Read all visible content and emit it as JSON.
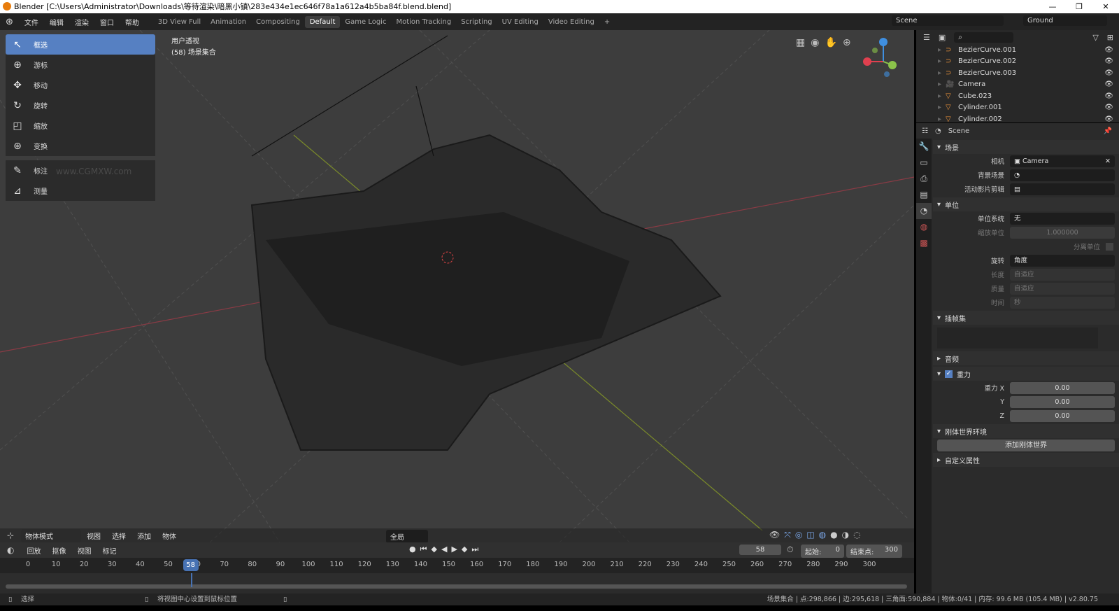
{
  "window": {
    "title": "Blender [C:\\Users\\Administrator\\Downloads\\等待渲染\\暗黑小镇\\283e434e1ec646f78a1a612a4b5ba84f.blend.blend]",
    "controls": [
      "—",
      "❐",
      "✕"
    ]
  },
  "menu": [
    "文件",
    "编辑",
    "渲染",
    "窗口",
    "帮助"
  ],
  "workspaces": [
    {
      "label": "3D View Full"
    },
    {
      "label": "Animation"
    },
    {
      "label": "Compositing"
    },
    {
      "label": "Default",
      "active": true
    },
    {
      "label": "Game Logic"
    },
    {
      "label": "Motion Tracking"
    },
    {
      "label": "Scripting"
    },
    {
      "label": "UV Editing"
    },
    {
      "label": "Video Editing"
    }
  ],
  "add_workspace": "+",
  "scene": {
    "name": "Scene",
    "layer": "Ground"
  },
  "tools": [
    {
      "label": "框选",
      "icon": "select-box-icon",
      "glyph": "↖",
      "active": true
    },
    {
      "label": "游标",
      "icon": "cursor-icon",
      "glyph": "⊕"
    },
    {
      "label": "移动",
      "icon": "move-icon",
      "glyph": "✥"
    },
    {
      "label": "旋转",
      "icon": "rotate-icon",
      "glyph": "↻"
    },
    {
      "label": "缩放",
      "icon": "scale-icon",
      "glyph": "◰"
    },
    {
      "label": "变换",
      "icon": "transform-icon",
      "glyph": "⊛"
    },
    {
      "label": "标注",
      "icon": "annotate-icon",
      "glyph": "✎"
    },
    {
      "label": "测量",
      "icon": "measure-icon",
      "glyph": "📐"
    }
  ],
  "viewport": {
    "view_name": "用户透视",
    "collection": "(58) 场景集合",
    "axis_colors": {
      "x": "#e0404f",
      "y": "#8bc34a",
      "z": "#3f8fe0"
    }
  },
  "viewport_header": {
    "mode": "物体模式",
    "menus": [
      "视图",
      "选择",
      "添加",
      "物体"
    ],
    "orientation": "全局"
  },
  "timeline": {
    "menus": [
      "回放",
      "抠像",
      "视图",
      "标记"
    ],
    "current_frame": "58",
    "start_label": "起始:",
    "start": "0",
    "end_label": "结束点:",
    "end": "300",
    "ticks": [
      0,
      10,
      20,
      30,
      40,
      50,
      60,
      70,
      80,
      90,
      100,
      110,
      120,
      130,
      140,
      150,
      160,
      170,
      180,
      190,
      200,
      210,
      220,
      230,
      240,
      250,
      260,
      270,
      280,
      290,
      300
    ],
    "current": 58
  },
  "outliner": {
    "items": [
      {
        "name": "BezierCurve.001",
        "icon": "curve-icon"
      },
      {
        "name": "BezierCurve.002",
        "icon": "curve-icon"
      },
      {
        "name": "BezierCurve.003",
        "icon": "curve-icon"
      },
      {
        "name": "Camera",
        "icon": "camera-icon"
      },
      {
        "name": "Cube.023",
        "icon": "mesh-icon"
      },
      {
        "name": "Cylinder.001",
        "icon": "mesh-icon"
      },
      {
        "name": "Cylinder.002",
        "icon": "mesh-icon"
      }
    ]
  },
  "properties": {
    "header": "Scene",
    "scene_section": "场景",
    "camera_label": "相机",
    "camera": "Camera",
    "bg_label": "背景场景",
    "clip_label": "活动影片剪辑",
    "units_section": "单位",
    "unit_system_label": "单位系统",
    "unit_system": "无",
    "unit_scale_label": "缩放单位",
    "unit_scale": "1.000000",
    "separate_label": "分离单位",
    "rotation_label": "旋转",
    "rotation": "角度",
    "length_label": "长度",
    "length": "自适应",
    "mass_label": "质量",
    "mass": "自适应",
    "time_label": "时间",
    "time": "秒",
    "keying_section": "插帧集",
    "audio_section": "音频",
    "gravity_section": "重力",
    "gravity_x_label": "重力 X",
    "gravity_y_label": "Y",
    "gravity_z_label": "Z",
    "gravity_x": "0.00",
    "gravity_y": "0.00",
    "gravity_z": "0.00",
    "rigid_section": "刚体世界环境",
    "rigid_button": "添加刚体世界",
    "custom_section": "自定义属性"
  },
  "status": {
    "left": "选择",
    "middle": "将视图中心设置到鼠标位置",
    "right": "场景集合 | 点:298,866 | 边:295,618 | 三角面:590,884 | 物体:0/41 | 内存: 99.6 MB (105.4 MB) | v2.80.75"
  },
  "watermark": "www.CGMXW.com"
}
